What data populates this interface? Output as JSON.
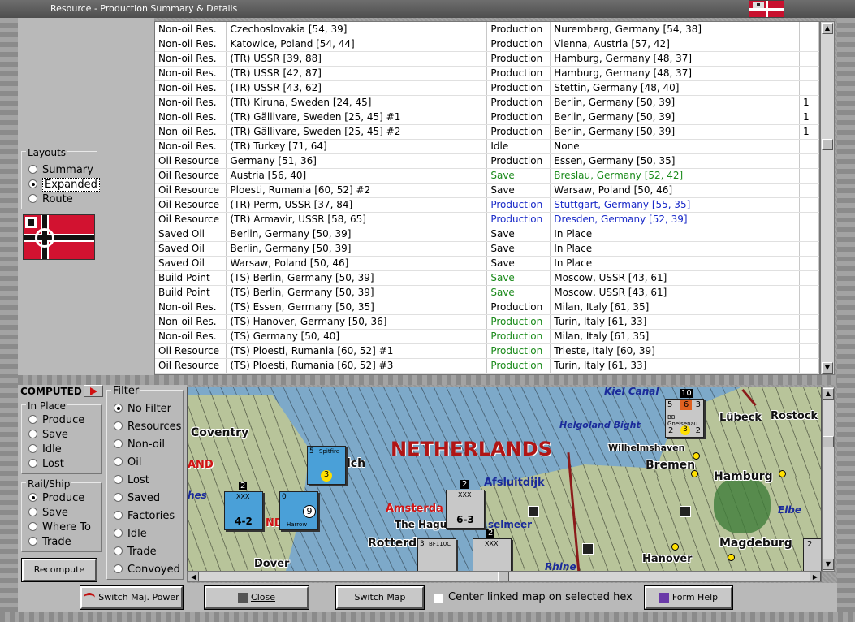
{
  "window": {
    "title": "Resource - Production Summary & Details"
  },
  "layouts": {
    "title": "Layouts",
    "options": [
      {
        "label": "Summary",
        "selected": false
      },
      {
        "label": "Expanded",
        "selected": true
      },
      {
        "label": "Route",
        "selected": false
      }
    ]
  },
  "table": {
    "rows": [
      {
        "type": "Non-oil Res.",
        "source": "Czechoslovakia [54, 39]",
        "action": "Production",
        "dest": "Nuremberg, Germany [54, 38]",
        "extra": "",
        "color": "black"
      },
      {
        "type": "Non-oil Res.",
        "source": "Katowice, Poland [54, 44]",
        "action": "Production",
        "dest": "Vienna, Austria [57, 42]",
        "extra": "",
        "color": "black"
      },
      {
        "type": "Non-oil Res.",
        "source": "(TR) USSR [39, 88]",
        "action": "Production",
        "dest": "Hamburg, Germany [48, 37]",
        "extra": "",
        "color": "black"
      },
      {
        "type": "Non-oil Res.",
        "source": "(TR) USSR [42, 87]",
        "action": "Production",
        "dest": "Hamburg, Germany [48, 37]",
        "extra": "",
        "color": "black"
      },
      {
        "type": "Non-oil Res.",
        "source": "(TR) USSR [43, 62]",
        "action": "Production",
        "dest": "Stettin, Germany [48, 40]",
        "extra": "",
        "color": "black"
      },
      {
        "type": "Non-oil Res.",
        "source": "(TR) Kiruna, Sweden [24, 45]",
        "action": "Production",
        "dest": "Berlin, Germany [50, 39]",
        "extra": "1",
        "color": "black"
      },
      {
        "type": "Non-oil Res.",
        "source": "(TR) Gällivare, Sweden [25, 45] #1",
        "action": "Production",
        "dest": "Berlin, Germany [50, 39]",
        "extra": "1",
        "color": "black"
      },
      {
        "type": "Non-oil Res.",
        "source": "(TR) Gällivare, Sweden [25, 45] #2",
        "action": "Production",
        "dest": "Berlin, Germany [50, 39]",
        "extra": "1",
        "color": "black"
      },
      {
        "type": "Non-oil Res.",
        "source": "(TR) Turkey [71, 64]",
        "action": "Idle",
        "dest": "None",
        "extra": "",
        "color": "black"
      },
      {
        "type": "Oil Resource",
        "source": "Germany [51, 36]",
        "action": "Production",
        "dest": "Essen, Germany [50, 35]",
        "extra": "",
        "color": "black"
      },
      {
        "type": "Oil Resource",
        "source": "Austria [56, 40]",
        "action": "Save",
        "dest": "Breslau, Germany [52, 42]",
        "extra": "",
        "color": "green"
      },
      {
        "type": "Oil Resource",
        "source": "Ploesti, Rumania [60, 52] #2",
        "action": "Save",
        "dest": "Warsaw, Poland [50, 46]",
        "extra": "",
        "color": "black"
      },
      {
        "type": "Oil Resource",
        "source": "(TR) Perm, USSR [37, 84]",
        "action": "Production",
        "dest": "Stuttgart, Germany [55, 35]",
        "extra": "",
        "color": "blue"
      },
      {
        "type": "Oil Resource",
        "source": "(TR) Armavir, USSR [58, 65]",
        "action": "Production",
        "dest": "Dresden, Germany [52, 39]",
        "extra": "",
        "color": "blue"
      },
      {
        "type": "Saved Oil",
        "source": "Berlin, Germany [50, 39]",
        "action": "Save",
        "dest": "In Place",
        "extra": "",
        "color": "black"
      },
      {
        "type": "Saved Oil",
        "source": "Berlin, Germany [50, 39]",
        "action": "Save",
        "dest": "In Place",
        "extra": "",
        "color": "black"
      },
      {
        "type": "Saved Oil",
        "source": "Warsaw, Poland [50, 46]",
        "action": "Save",
        "dest": "In Place",
        "extra": "",
        "color": "black"
      },
      {
        "type": "Build Point",
        "source": "(TS) Berlin, Germany [50, 39]",
        "action": "Save",
        "dest": "Moscow, USSR [43, 61]",
        "extra": "",
        "color": "green3"
      },
      {
        "type": "Build Point",
        "source": "(TS) Berlin, Germany [50, 39]",
        "action": "Save",
        "dest": "Moscow, USSR [43, 61]",
        "extra": "",
        "color": "green3"
      },
      {
        "type": "Non-oil Res.",
        "source": "(TS) Essen, Germany [50, 35]",
        "action": "Production",
        "dest": "Milan, Italy [61, 35]",
        "extra": "",
        "color": "black"
      },
      {
        "type": "Non-oil Res.",
        "source": "(TS) Hanover, Germany [50, 36]",
        "action": "Production",
        "dest": "Turin, Italy [61, 33]",
        "extra": "",
        "color": "green3"
      },
      {
        "type": "Non-oil Res.",
        "source": "(TS) Germany [50, 40]",
        "action": "Production",
        "dest": "Milan, Italy [61, 35]",
        "extra": "",
        "color": "green3"
      },
      {
        "type": "Oil Resource",
        "source": "(TS) Ploesti, Rumania [60, 52] #1",
        "action": "Production",
        "dest": "Trieste, Italy [60, 39]",
        "extra": "",
        "color": "green3"
      },
      {
        "type": "Oil Resource",
        "source": "(TS) Ploesti, Rumania [60, 52] #3",
        "action": "Production",
        "dest": "Turin, Italy [61, 33]",
        "extra": "",
        "color": "green3"
      }
    ]
  },
  "computed": {
    "label": "COMPUTED"
  },
  "in_place": {
    "title": "In Place",
    "options": [
      {
        "label": "Produce",
        "selected": false
      },
      {
        "label": "Save",
        "selected": false
      },
      {
        "label": "Idle",
        "selected": false
      },
      {
        "label": "Lost",
        "selected": false
      }
    ]
  },
  "rail_ship": {
    "title": "Rail/Ship",
    "options": [
      {
        "label": "Produce",
        "selected": true
      },
      {
        "label": "Save",
        "selected": false
      },
      {
        "label": "Where To",
        "selected": false
      },
      {
        "label": "Trade",
        "selected": false
      }
    ]
  },
  "filter": {
    "title": "Filter",
    "options": [
      {
        "label": "No Filter",
        "selected": true
      },
      {
        "label": "Resources",
        "selected": false
      },
      {
        "label": "Non-oil",
        "selected": false
      },
      {
        "label": "Oil",
        "selected": false
      },
      {
        "label": "Lost",
        "selected": false
      },
      {
        "label": "Saved",
        "selected": false
      },
      {
        "label": "Factories",
        "selected": false
      },
      {
        "label": "Idle",
        "selected": false
      },
      {
        "label": "Trade",
        "selected": false
      },
      {
        "label": "Convoyed",
        "selected": false
      }
    ]
  },
  "recompute_label": "Recompute",
  "map": {
    "labels": {
      "kiel_canal": "Kiel Canal",
      "lubeck": "Lübeck",
      "rostock": "Rostock",
      "helgoland_bight": "Helgoland Bight",
      "wilhelmshaven": "Wilhelmshaven",
      "bremen": "Bremen",
      "hamburg": "Hamburg",
      "netherlands": "NETHERLANDS",
      "coventry": "Coventry",
      "afsluitdijk": "Afsluitdijk",
      "amsterdam": "Amsterda",
      "the_hague": "The Hagu",
      "ijsselmeer": "selmeer",
      "rotterdam": "Rotterd",
      "elbe": "Elbe",
      "magdeburg": "Magdeburg",
      "hanover": "Hanover",
      "dover": "Dover",
      "rhine": "Rhine",
      "wich": "ich",
      "and": "AND",
      "nes": "hes",
      "nd": "ND"
    },
    "units": {
      "spitfire": {
        "name": "Spitfire",
        "value": "3",
        "top": "5"
      },
      "harrow": {
        "name": "Harrow",
        "value": "9",
        "top": "0"
      },
      "british_army": {
        "size": "XXX",
        "value": "4-2",
        "top": "2"
      },
      "dutch_corps": {
        "size": "XXX",
        "value": "6-3",
        "top": "2"
      },
      "ship": {
        "name": "BB Gneisenau",
        "left": "5",
        "mid": "6",
        "right": "3",
        "bottom_left": "2",
        "bottom_mid": "3",
        "bottom_right": "2",
        "stack": "10"
      },
      "bf110": {
        "name": "BF110C",
        "top": "3"
      },
      "inf2": {
        "size": "XXX",
        "top": "2"
      },
      "inf_edge": {
        "top": "2"
      }
    }
  },
  "buttons": {
    "switch_major_power": "Switch Maj. Power",
    "close": "Close",
    "switch_map": "Switch Map",
    "form_help": "Form Help"
  },
  "center_linked_map": "Center linked map on selected hex"
}
